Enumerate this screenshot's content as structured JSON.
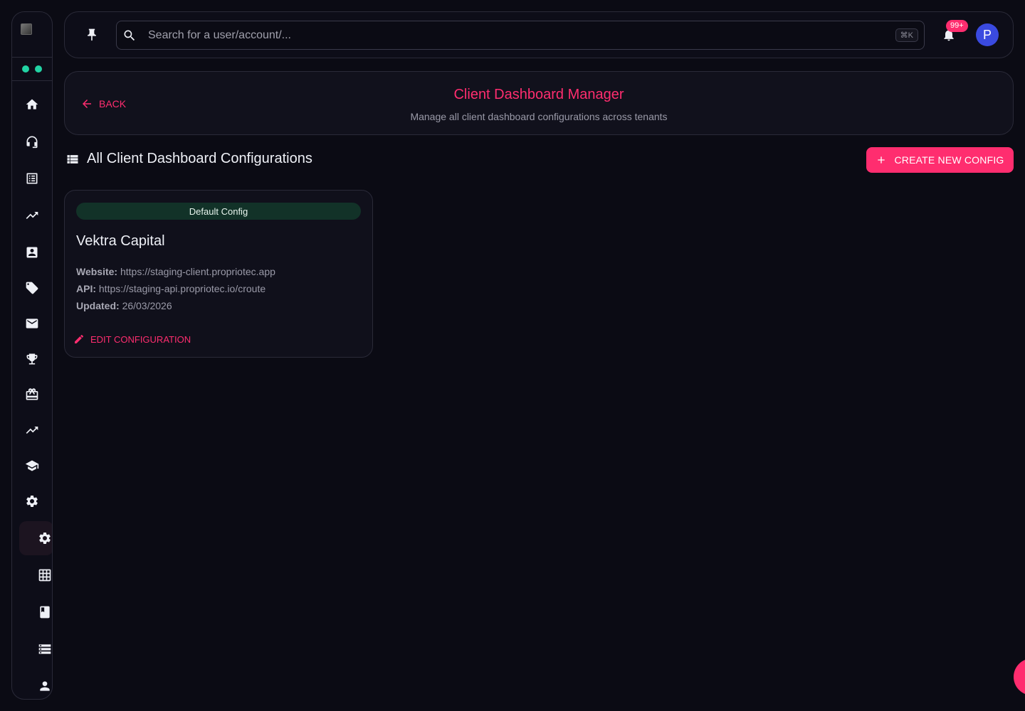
{
  "sidebar": {
    "items": [
      {
        "icon": "home-icon"
      },
      {
        "icon": "headset-icon"
      },
      {
        "icon": "list-alt-icon"
      },
      {
        "icon": "trending-up-icon"
      },
      {
        "icon": "contact-card-icon"
      },
      {
        "icon": "tag-icon"
      },
      {
        "icon": "mail-icon"
      },
      {
        "icon": "trophy-icon"
      },
      {
        "icon": "card-giftcard-icon"
      },
      {
        "icon": "trending-up-icon"
      },
      {
        "icon": "school-icon"
      },
      {
        "icon": "settings-icon"
      },
      {
        "icon": "settings-icon",
        "active": true
      },
      {
        "icon": "grid-icon"
      },
      {
        "icon": "book-icon"
      },
      {
        "icon": "storage-icon"
      },
      {
        "icon": "person-icon"
      }
    ]
  },
  "topbar": {
    "search_placeholder": "Search for a user/account/...",
    "shortcut": "⌘K",
    "notification_count": "99+",
    "avatar_initial": "P"
  },
  "header": {
    "back_label": "BACK",
    "title": "Client Dashboard Manager",
    "subtitle": "Manage all client dashboard configurations across tenants"
  },
  "section": {
    "title": "All Client Dashboard Configurations",
    "create_label": "CREATE NEW CONFIG"
  },
  "configs": [
    {
      "chip": "Default Config",
      "name": "Vektra Capital",
      "website_label": "Website:",
      "website": "https://staging-client.propriotec.app",
      "api_label": "API:",
      "api": "https://staging-api.propriotec.io/croute",
      "updated_label": "Updated:",
      "updated": "26/03/2026",
      "edit_label": "EDIT CONFIGURATION"
    }
  ],
  "colors": {
    "accent": "#ff2d6f",
    "background": "#0b0b14",
    "status_dot": "#22d3a4",
    "chip_bg": "#123228",
    "avatar": "#3a4ae0"
  }
}
